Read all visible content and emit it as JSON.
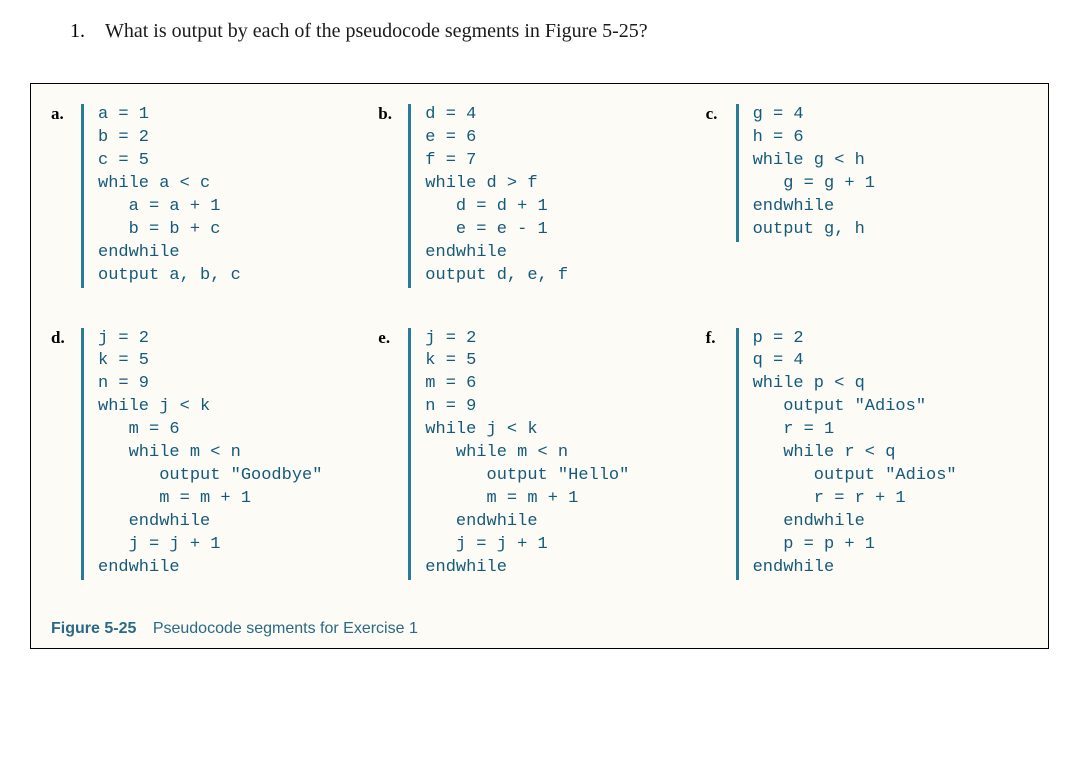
{
  "question": {
    "number": "1.",
    "text": "What is output by each of the pseudocode segments in Figure 5-25?"
  },
  "segments": {
    "a": {
      "label": "a.",
      "code": "a = 1\nb = 2\nc = 5\nwhile a < c\n   a = a + 1\n   b = b + c\nendwhile\noutput a, b, c"
    },
    "b": {
      "label": "b.",
      "code": "d = 4\ne = 6\nf = 7\nwhile d > f\n   d = d + 1\n   e = e - 1\nendwhile\noutput d, e, f"
    },
    "c": {
      "label": "c.",
      "code": "g = 4\nh = 6\nwhile g < h\n   g = g + 1\nendwhile\noutput g, h"
    },
    "d": {
      "label": "d.",
      "code": "j = 2\nk = 5\nn = 9\nwhile j < k\n   m = 6\n   while m < n\n      output \"Goodbye\"\n      m = m + 1\n   endwhile\n   j = j + 1\nendwhile"
    },
    "e": {
      "label": "e.",
      "code": "j = 2\nk = 5\nm = 6\nn = 9\nwhile j < k\n   while m < n\n      output \"Hello\"\n      m = m + 1\n   endwhile\n   j = j + 1\nendwhile"
    },
    "f": {
      "label": "f.",
      "code": "p = 2\nq = 4\nwhile p < q\n   output \"Adios\"\n   r = 1\n   while r < q\n      output \"Adios\"\n      r = r + 1\n   endwhile\n   p = p + 1\nendwhile"
    }
  },
  "figure": {
    "label": "Figure 5-25",
    "description": "Pseudocode segments for Exercise 1"
  }
}
